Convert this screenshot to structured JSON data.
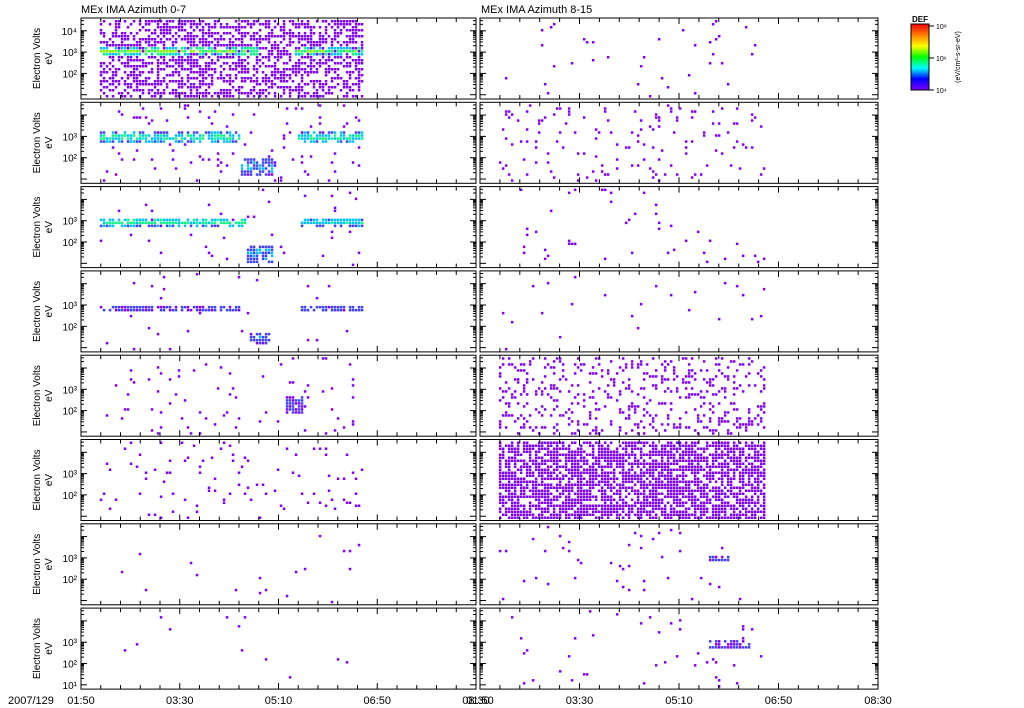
{
  "chart_data": {
    "type": "heatmap",
    "title_left": "MEx IMA Azimuth 0-7",
    "title_right": "MEx IMA Azimuth 8-15",
    "ylabel": "Electron Volts",
    "yunit": "eV",
    "date_label": "2007/129",
    "x_ticks": [
      "01:50",
      "03:30",
      "05:10",
      "06:50",
      "08:30"
    ],
    "x_range_minutes": [
      0,
      400
    ],
    "ylim_log10": [
      0.8,
      4.6
    ],
    "colorbar": {
      "label": "DEF",
      "ticks": [
        "10⁸",
        "10⁶",
        "10⁴"
      ],
      "units": "(eV/cm²-s-sr-eV)"
    },
    "colors": [
      "#7f00ff",
      "#3f3fff",
      "#00bfff",
      "#00ff7f",
      "#7fff00",
      "#ffff00",
      "#ff7f00",
      "#ff0000"
    ],
    "panels": [
      {
        "left": {
          "bg": 0.55,
          "bands": [
            {
              "e": 3.1,
              "w": 0.25,
              "t0": 19,
              "t1": 180,
              "lvl": 0.45
            },
            {
              "e": 3.1,
              "w": 0.25,
              "t0": 215,
              "t1": 285,
              "lvl": 0.4
            }
          ],
          "ticks": [
            "10⁴",
            "10³",
            "10²"
          ]
        },
        "right": {
          "bg": 0.02,
          "bands": []
        }
      },
      {
        "left": {
          "bg": 0.05,
          "bands": [
            {
              "e": 3.0,
              "w": 0.25,
              "t0": 19,
              "t1": 160,
              "lvl": 0.35
            },
            {
              "e": 3.0,
              "w": 0.25,
              "t0": 218,
              "t1": 285,
              "lvl": 0.35
            },
            {
              "e": 1.6,
              "w": 0.4,
              "t0": 160,
              "t1": 195,
              "lvl": 0.2
            }
          ],
          "ticks": [
            "10³",
            "10²"
          ]
        },
        "right": {
          "bg": 0.06,
          "bands": []
        }
      },
      {
        "left": {
          "bg": 0.02,
          "bands": [
            {
              "e": 3.0,
              "w": 0.2,
              "t0": 19,
              "t1": 165,
              "lvl": 0.4
            },
            {
              "e": 3.0,
              "w": 0.2,
              "t0": 220,
              "t1": 285,
              "lvl": 0.3
            },
            {
              "e": 1.5,
              "w": 0.4,
              "t0": 165,
              "t1": 195,
              "lvl": 0.2
            }
          ],
          "ticks": [
            "10³",
            "10²"
          ]
        },
        "right": {
          "bg": 0.02,
          "bands": []
        }
      },
      {
        "left": {
          "bg": 0.01,
          "bands": [
            {
              "e": 2.9,
              "w": 0.15,
              "t0": 19,
              "t1": 160,
              "lvl": 0.1
            },
            {
              "e": 2.9,
              "w": 0.15,
              "t0": 220,
              "t1": 285,
              "lvl": 0.15
            },
            {
              "e": 1.5,
              "w": 0.3,
              "t0": 170,
              "t1": 190,
              "lvl": 0.15
            }
          ],
          "ticks": [
            "10³",
            "10²"
          ]
        },
        "right": {
          "bg": 0.01,
          "bands": []
        }
      },
      {
        "left": {
          "bg": 0.03,
          "bands": [
            {
              "e": 2.3,
              "w": 0.4,
              "t0": 205,
              "t1": 225,
              "lvl": 0.05
            }
          ],
          "ticks": [
            "10³",
            "10²"
          ]
        },
        "right": {
          "bg": 0.2,
          "bands": []
        }
      },
      {
        "left": {
          "bg": 0.04,
          "bands": [],
          "ticks": [
            "10³",
            "10²"
          ]
        },
        "right": {
          "bg": 0.7,
          "bands": []
        }
      },
      {
        "left": {
          "bg": 0.008,
          "bands": [],
          "ticks": [
            "10³",
            "10²"
          ]
        },
        "right": {
          "bg": 0.015,
          "bands": [
            {
              "e": 3.0,
              "w": 0.15,
              "t0": 230,
              "t1": 250,
              "lvl": 0.05
            }
          ]
        }
      },
      {
        "left": {
          "bg": 0.006,
          "bands": [],
          "ticks": [
            "10³",
            "10²",
            "10¹"
          ]
        },
        "right": {
          "bg": 0.02,
          "bands": [
            {
              "e": 2.9,
              "w": 0.2,
              "t0": 230,
              "t1": 270,
              "lvl": 0.1
            }
          ]
        }
      }
    ]
  }
}
